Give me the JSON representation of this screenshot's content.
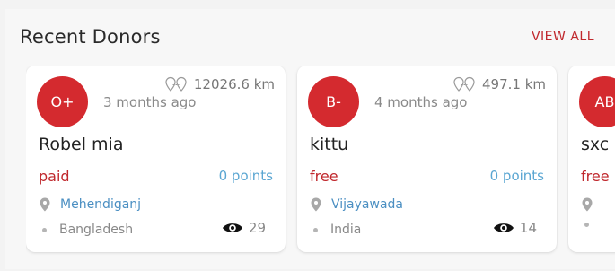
{
  "section": {
    "title": "Recent Donors",
    "view_all": "VIEW ALL"
  },
  "colors": {
    "accent": "#c0282d",
    "badge": "#d42a2f",
    "points": "#5aa6d2",
    "city": "#4b8fc2"
  },
  "donors": [
    {
      "blood_group": "O+",
      "distance": "12026.6 km",
      "time_ago": "3 months ago",
      "name": "Robel mia",
      "payment": "paid",
      "points": "0 points",
      "city": "Mehendiganj",
      "country": "Bangladesh",
      "views": "29"
    },
    {
      "blood_group": "B-",
      "distance": "497.1 km",
      "time_ago": "4 months ago",
      "name": "kittu",
      "payment": "free",
      "points": "0 points",
      "city": "Vijayawada",
      "country": "India",
      "views": "14"
    },
    {
      "blood_group": "AB",
      "name": "sxc",
      "payment": "free"
    }
  ],
  "icons": {
    "distance": "location-pins-icon",
    "city": "map-marker-icon",
    "views": "eye-icon"
  }
}
